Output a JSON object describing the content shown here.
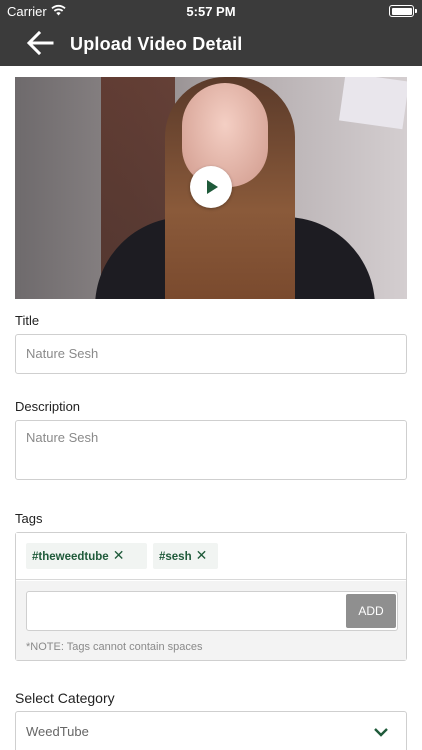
{
  "status_bar": {
    "carrier": "Carrier",
    "time": "5:57 PM"
  },
  "header": {
    "title": "Upload Video Detail"
  },
  "form": {
    "title_label": "Title",
    "title_value": "Nature Sesh",
    "description_label": "Description",
    "description_value": "Nature Sesh",
    "tags_label": "Tags",
    "tags": [
      {
        "text": "#theweedtube"
      },
      {
        "text": "#sesh"
      }
    ],
    "tag_input_value": "",
    "add_button_label": "ADD",
    "tags_note": "*NOTE: Tags cannot contain spaces",
    "category_label": "Select Category",
    "category_value": "WeedTube"
  },
  "colors": {
    "header_bg": "#3b3b3b",
    "accent_green": "#1f5a3a",
    "add_button_bg": "#8f8f8f"
  },
  "icons": [
    "wifi-icon",
    "battery-icon",
    "back-arrow-icon",
    "play-icon",
    "close-icon",
    "chevron-down-icon"
  ]
}
